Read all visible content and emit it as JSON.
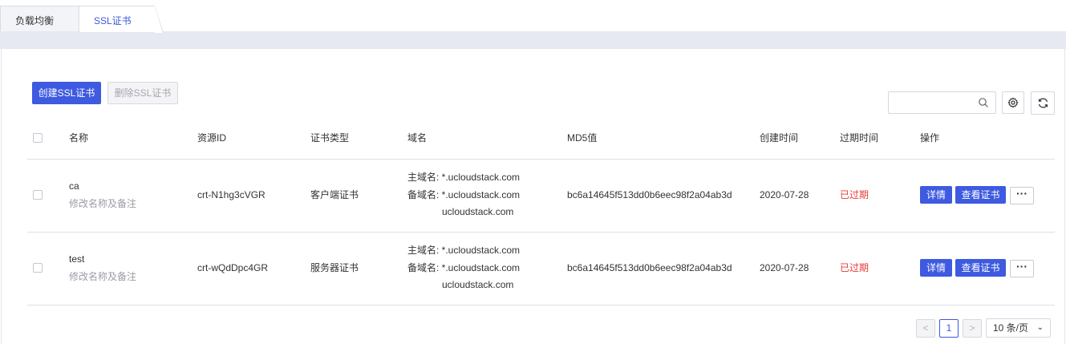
{
  "tabs": [
    {
      "label": "负载均衡",
      "active": false
    },
    {
      "label": "SSL证书",
      "active": true
    }
  ],
  "toolbar": {
    "create_label": "创建SSL证书",
    "delete_label": "删除SSL证书",
    "search_placeholder": "",
    "search_icon": "search-icon",
    "settings_icon": "gear-icon",
    "refresh_icon": "refresh-icon"
  },
  "table": {
    "columns": [
      "名称",
      "资源ID",
      "证书类型",
      "域名",
      "MD5值",
      "创建时间",
      "过期时间",
      "操作"
    ],
    "rows": [
      {
        "name": "ca",
        "name_action": "修改名称及备注",
        "resource_id": "crt-N1hg3cVGR",
        "type": "客户端证书",
        "primary_domain_label": "主域名: ",
        "primary_domain": "*.ucloudstack.com",
        "alt_domain_label": "备域名: ",
        "alt_domain_1": "*.ucloudstack.com",
        "alt_domain_2": "ucloudstack.com",
        "md5": "bc6a14645f513dd0b6eec98f2a04ab3d",
        "created": "2020-07-28",
        "expiry": "已过期",
        "detail_label": "详情",
        "view_label": "查看证书",
        "more_label": "···"
      },
      {
        "name": "test",
        "name_action": "修改名称及备注",
        "resource_id": "crt-wQdDpc4GR",
        "type": "服务器证书",
        "primary_domain_label": "主域名: ",
        "primary_domain": "*.ucloudstack.com",
        "alt_domain_label": "备域名: ",
        "alt_domain_1": "*.ucloudstack.com",
        "alt_domain_2": "ucloudstack.com",
        "md5": "bc6a14645f513dd0b6eec98f2a04ab3d",
        "created": "2020-07-28",
        "expiry": "已过期",
        "detail_label": "详情",
        "view_label": "查看证书",
        "more_label": "···"
      }
    ]
  },
  "pagination": {
    "prev": "<",
    "current_page": "1",
    "next": ">",
    "page_size": "10 条/页",
    "chevron": "⌄"
  },
  "colors": {
    "accent": "#3d5ae0",
    "expired": "#e53935",
    "tab_active_text": "#3b5bdb"
  }
}
